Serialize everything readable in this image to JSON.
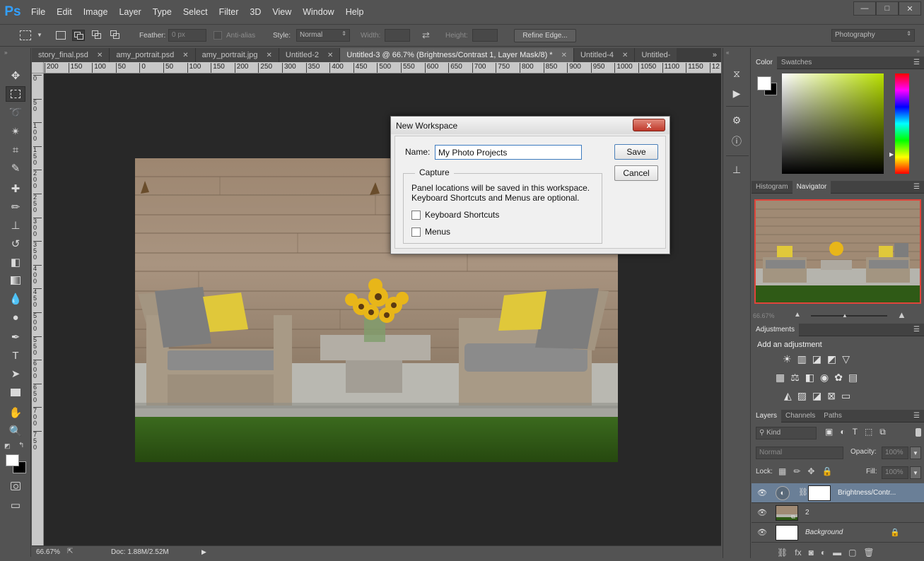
{
  "app": {
    "logo": "Ps"
  },
  "menu": [
    "File",
    "Edit",
    "Image",
    "Layer",
    "Type",
    "Select",
    "Filter",
    "3D",
    "View",
    "Window",
    "Help"
  ],
  "options": {
    "feather_label": "Feather:",
    "feather_value": "0 px",
    "antialias_label": "Anti-alias",
    "style_label": "Style:",
    "style_value": "Normal",
    "width_label": "Width:",
    "height_label": "Height:",
    "refine_edge": "Refine Edge...",
    "workspace": "Photography"
  },
  "tabs": [
    {
      "label": "story_final.psd",
      "active": false
    },
    {
      "label": "amy_portrait.psd",
      "active": false
    },
    {
      "label": "amy_portrait.jpg",
      "active": false
    },
    {
      "label": "Untitled-2",
      "active": false
    },
    {
      "label": "Untitled-3 @ 66.7% (Brightness/Contrast 1, Layer Mask/8) *",
      "active": true
    },
    {
      "label": "Untitled-4",
      "active": false
    },
    {
      "label": "Untitled-",
      "active": false
    }
  ],
  "ruler_h": [
    "200",
    "150",
    "100",
    "50",
    "0",
    "50",
    "100",
    "150",
    "200",
    "250",
    "300",
    "350",
    "400",
    "450",
    "500",
    "550",
    "600",
    "650",
    "700",
    "750",
    "800",
    "850",
    "900",
    "950",
    "1000",
    "1050",
    "1100",
    "1150",
    "12"
  ],
  "ruler_v": [
    "0",
    "5\n0",
    "1\n0\n0",
    "1\n5\n0",
    "2\n0\n0",
    "2\n5\n0",
    "3\n0\n0",
    "3\n5\n0",
    "4\n0\n0",
    "4\n5\n0",
    "5\n0\n0",
    "5\n5\n0",
    "6\n0\n0",
    "6\n5\n0",
    "7\n0\n0",
    "7\n5\n0"
  ],
  "status": {
    "zoom": "66.67%",
    "doc": "Doc: 1.88M/2.52M"
  },
  "dialog": {
    "title": "New Workspace",
    "close": "x",
    "name_label": "Name:",
    "name_value": "My Photo Projects",
    "save": "Save",
    "cancel": "Cancel",
    "capture_label": "Capture",
    "desc_line1": "Panel locations will be saved in this workspace.",
    "desc_line2": "Keyboard Shortcuts and Menus are optional.",
    "opt_keyboard": "Keyboard Shortcuts",
    "opt_menus": "Menus"
  },
  "color_panel": {
    "tabs": [
      "Color",
      "Swatches"
    ]
  },
  "navigator": {
    "tabs": [
      "Histogram",
      "Navigator"
    ],
    "zoom": "66.67%"
  },
  "adjustments": {
    "tab": "Adjustments",
    "heading": "Add an adjustment"
  },
  "layers": {
    "tabs": [
      "Layers",
      "Channels",
      "Paths"
    ],
    "kind": "Kind",
    "blend": "Normal",
    "opacity_label": "Opacity:",
    "opacity": "100%",
    "lock_label": "Lock:",
    "fill_label": "Fill:",
    "fill": "100%",
    "items": [
      {
        "name": "Brightness/Contr...",
        "selected": true
      },
      {
        "name": "2",
        "selected": false
      },
      {
        "name": "Background",
        "selected": false
      }
    ]
  },
  "colors": {
    "accent_red": "#e0443a",
    "selected_layer": "#6a7f97",
    "ps_blue": "#32a0ff"
  }
}
